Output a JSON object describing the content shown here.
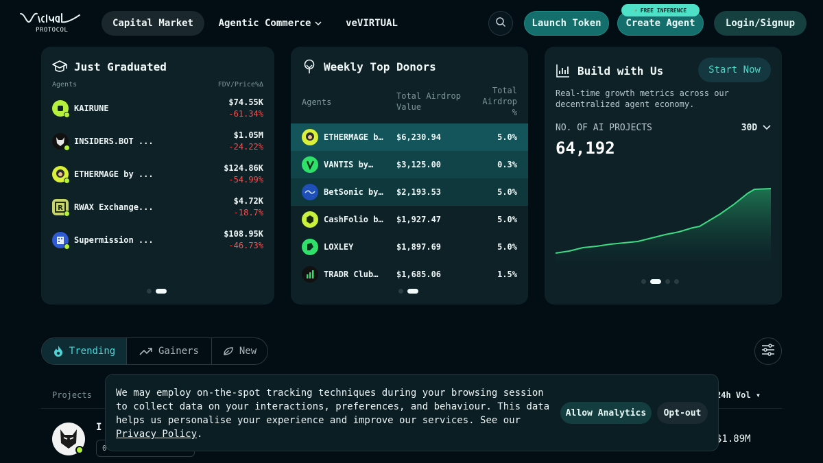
{
  "brand": {
    "name": "Virtuals",
    "sub": "PROTOCOL"
  },
  "nav": {
    "items": [
      "Capital Market",
      "Agentic Commerce",
      "veVIRTUAL"
    ],
    "launch": "Launch Token",
    "create": "Create Agent",
    "free_badge": "FREE INFERENCE",
    "login": "Login/Signup"
  },
  "graduated": {
    "title": "Just Graduated",
    "col_agents": "Agents",
    "col_price": "FDV/Price%Δ",
    "rows": [
      {
        "name": "KAIRUNE",
        "price": "$74.55K",
        "change": "-61.34%",
        "color": "#b4f03c",
        "icon": "k-badge-icon"
      },
      {
        "name": "INSIDERS.BOT ...",
        "price": "$1.05M",
        "change": "-24.22%",
        "color": "#111111",
        "icon": "wolf-icon"
      },
      {
        "name": "ETHERMAGE by ...",
        "price": "$124.86K",
        "change": "-54.99%",
        "color": "#d9ef3a",
        "icon": "mage-icon"
      },
      {
        "name": "RWAX Exchange...",
        "price": "$4.72K",
        "change": "-18.7%",
        "color": "#c7d46a",
        "icon": "r-badge-icon"
      },
      {
        "name": "Supermission ...",
        "price": "$108.95K",
        "change": "-46.73%",
        "color": "#2f5bd3",
        "icon": "building-icon"
      }
    ]
  },
  "donors": {
    "title": "Weekly Top Donors",
    "col_agents": "Agents",
    "col_value": "Total Airdrop Value",
    "col_pct": "Total Airdrop %",
    "rows": [
      {
        "name": "ETHERMAGE b…",
        "value": "$6,230.94",
        "pct": "5.0%",
        "color": "#d9ef3a",
        "icon": "mage-icon"
      },
      {
        "name": "VANTIS by…",
        "value": "$3,125.00",
        "pct": "0.3%",
        "color": "#2fe06a",
        "icon": "v-logo-icon"
      },
      {
        "name": "BetSonic by…",
        "value": "$2,193.53",
        "pct": "5.0%",
        "color": "#1f4fb8",
        "icon": "betsonic-icon"
      },
      {
        "name": "CashFolio b…",
        "value": "$1,927.47",
        "pct": "5.0%",
        "color": "#c8f03c",
        "icon": "cashfolio-icon"
      },
      {
        "name": "LOXLEY",
        "value": "$1,897.69",
        "pct": "5.0%",
        "color": "#2fe06a",
        "icon": "loxley-icon"
      },
      {
        "name": "TRADR Club…",
        "value": "$1,685.06",
        "pct": "1.5%",
        "color": "#111111",
        "icon": "candles-icon"
      }
    ]
  },
  "build": {
    "title": "Build with Us",
    "cta": "Start Now",
    "desc": "Real-time growth metrics across our decentralized agent economy.",
    "metric_label": "NO. OF AI PROJECTS",
    "range": "30D",
    "value": "64,192",
    "accent": "#3ddc84"
  },
  "tabs": [
    {
      "label": "Trending",
      "icon": "flame-icon"
    },
    {
      "label": "Gainers",
      "icon": "trend-up-icon"
    },
    {
      "label": "New",
      "icon": "leaf-icon"
    }
  ],
  "table": {
    "col_projects": "Projects",
    "col_vol": "24h Vol",
    "row": {
      "name": "I",
      "chip": "0",
      "vol": "$1.89M"
    }
  },
  "cookie": {
    "text": "We may employ on-the-spot tracking techniques during your browsing session to collect data on your interactions, preferences, and behaviour. This data helps us personalise your experience and improve our services. See our ",
    "link": "Privacy Policy",
    "tail": ".",
    "allow": "Allow Analytics",
    "opt_out": "Opt-out"
  }
}
